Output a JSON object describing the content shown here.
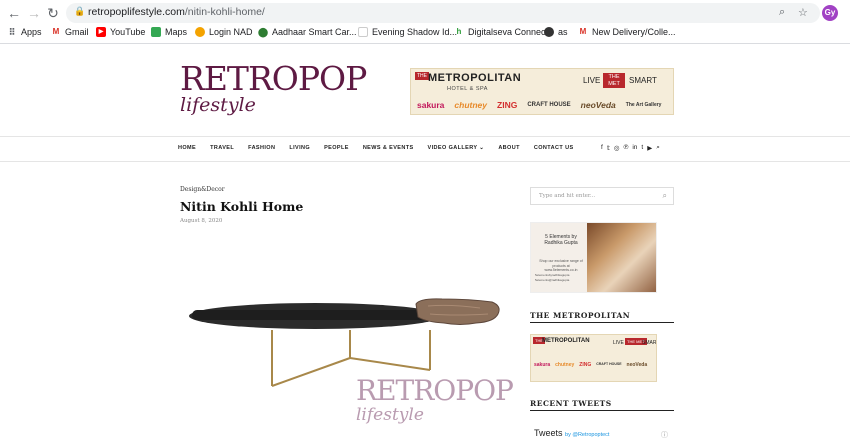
{
  "browser": {
    "url_domain": "retropoplifestyle.com",
    "url_path": "/nitin-kohli-home/",
    "profile_initials": "Gy",
    "bookmarks": [
      {
        "label": "Apps",
        "icon": "apps-grid-icon",
        "color": "#5f6368"
      },
      {
        "label": "Gmail",
        "icon": "gmail-icon",
        "color": "#d93025"
      },
      {
        "label": "YouTube",
        "icon": "youtube-icon",
        "color": "#ff0000"
      },
      {
        "label": "Maps",
        "icon": "maps-icon",
        "color": "#34a853"
      },
      {
        "label": "Login NAD",
        "icon": "nad-icon",
        "color": "#f4a300"
      },
      {
        "label": "Aadhaar Smart Car...",
        "icon": "location-pin-icon",
        "color": "#2e7d32"
      },
      {
        "label": "Evening Shadow Id...",
        "icon": "page-icon",
        "color": "#ffffff"
      },
      {
        "label": "Digitalseva Connect",
        "icon": "digitalseva-icon",
        "color": "#2e9d3a"
      },
      {
        "label": "as",
        "icon": "globe-icon",
        "color": "#333333"
      },
      {
        "label": "New Delivery/Colle...",
        "icon": "gmail-icon",
        "color": "#d93025"
      }
    ]
  },
  "site": {
    "logo_main": "RETROPOP",
    "logo_sub": "lifestyle",
    "brand_color": "#5e1a43",
    "banner": {
      "badge_left": "THE",
      "title": "METROPOLITAN",
      "subtitle": "HOTEL & SPA",
      "live": "LIVE",
      "badge_right": "THE MET",
      "smart": "SMART",
      "brands": [
        "sakura",
        "chutney",
        "ZING",
        "CRAFT HOUSE",
        "neoVeda",
        "The Art Gallery"
      ]
    },
    "nav": [
      "HOME",
      "TRAVEL",
      "FASHION",
      "LIVING",
      "PEOPLE",
      "NEWS & EVENTS",
      "VIDEO GALLERY ⌄",
      "ABOUT",
      "CONTACT US"
    ],
    "social_icons": [
      "facebook-icon",
      "twitter-icon",
      "instagram-icon",
      "pinterest-icon",
      "linkedin-icon",
      "tumblr-icon",
      "youtube-icon",
      "search-icon"
    ]
  },
  "article": {
    "category": "Design&Decor",
    "title": "Nitin Kohli Home",
    "date": "August 8, 2020",
    "watermark_main": "RETROPOP",
    "watermark_sub": "lifestyle"
  },
  "sidebar": {
    "search_placeholder": "Type and hit enter...",
    "ad1_text": "5 Elements by Radhika Gupta",
    "ad1_shop": "Shop our exclusive range of products at www.5elements.co.in",
    "ad1_contact_1": "5elementsbyradhikagupta",
    "ad1_contact_2": "5elements@radhikagupta",
    "section_metropolitan": "THE METROPOLITAN",
    "section_tweets": "RECENT TWEETS",
    "tweets_label": "Tweets",
    "tweets_by": "by @Retropoptect"
  }
}
